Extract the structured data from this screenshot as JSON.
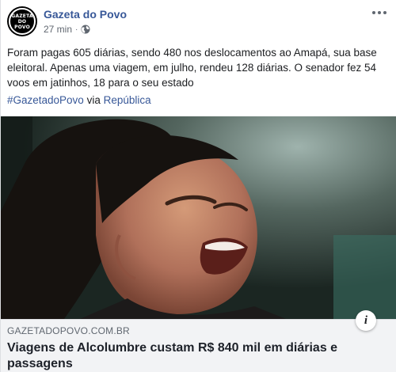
{
  "post": {
    "page_name": "Gazeta do Povo",
    "time": "27 min",
    "separator": "·",
    "avatar_text_line1": "GAZETA",
    "avatar_text_line2": "DO POVO",
    "privacy_icon": "globe-icon",
    "more_icon": "more-options-icon",
    "text": "Foram pagas 605 diárias, sendo 480 nos deslocamentos ao Amapá, sua base eleitoral. Apenas uma viagem, em julho, rendeu 128 diárias. O senador fez 54 voos em jatinhos, 18 para o seu estado",
    "hashtag": "#GazetadoPovo",
    "via_label": "via",
    "via_link": "República"
  },
  "link_preview": {
    "domain": "GAZETADOPOVO.COM.BR",
    "title": "Viagens de Alcolumbre custam R$ 840 mil em diárias e passagens",
    "info_icon": "i"
  },
  "colors": {
    "link": "#385898",
    "meta": "#606770",
    "caption_bg": "#f2f3f5"
  }
}
